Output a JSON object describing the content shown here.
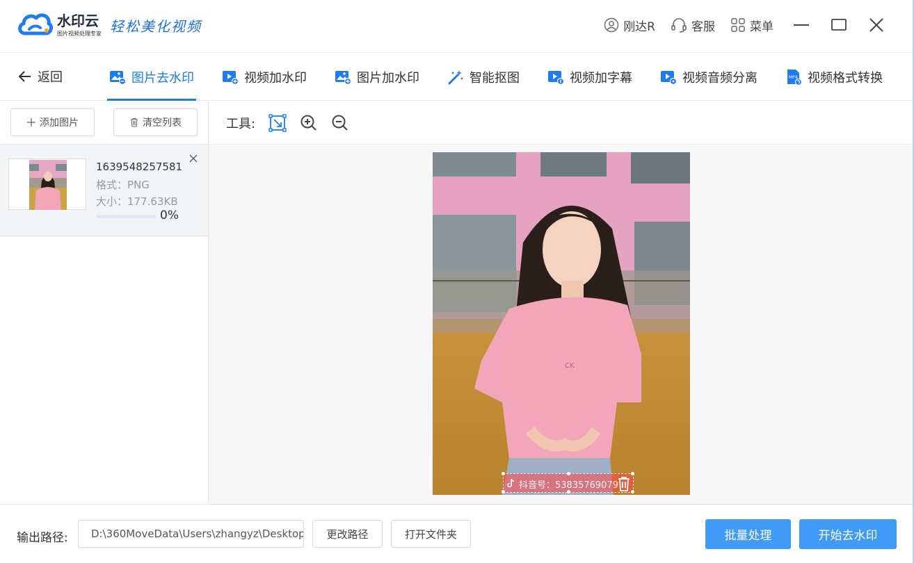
{
  "app": {
    "logo_name": "水印云",
    "logo_subtitle": "图片视频处理专家",
    "slogan": "轻松美化视频",
    "user_name": "刚达R",
    "service_label": "客服",
    "menu_label": "菜单",
    "user_icon": "user-circle-icon",
    "service_icon": "headset-icon",
    "menu_icon": "grid-menu-icon"
  },
  "nav": {
    "back_label": "返回",
    "tabs": [
      {
        "label": "图片去水印",
        "icon": "image-remove-icon",
        "active": true
      },
      {
        "label": "视频加水印",
        "icon": "video-add-icon",
        "active": false
      },
      {
        "label": "图片加水印",
        "icon": "image-add-icon",
        "active": false
      },
      {
        "label": "智能抠图",
        "icon": "magic-wand-icon",
        "active": false
      },
      {
        "label": "视频加字幕",
        "icon": "video-subtitle-icon",
        "active": false
      },
      {
        "label": "视频音频分离",
        "icon": "audio-split-icon",
        "active": false
      },
      {
        "label": "视频格式转换",
        "icon": "mp4-convert-icon",
        "active": false
      }
    ]
  },
  "left_panel": {
    "add_label": "添加图片",
    "clear_label": "清空列表",
    "files": [
      {
        "name": "1639548257581",
        "format": "格式：PNG",
        "size": "大小：177.63KB",
        "progress_pct": 0,
        "progress_text": "0%"
      }
    ]
  },
  "toolbar": {
    "label": "工具:"
  },
  "watermark": {
    "text": "抖音号：53835769079",
    "icon": "tiktok-icon",
    "delete_icon": "trash-icon"
  },
  "bottom": {
    "output_label": "输出路径:",
    "output_path": "D:\\360MoveData\\Users\\zhangyz\\Desktop",
    "change_path_label": "更改路径",
    "open_folder_label": "打开文件夹",
    "batch_label": "批量处理",
    "start_label": "开始去水印"
  },
  "colors": {
    "accent": "#1e7bf0",
    "primary_button": "#3f9bf5",
    "watermark_highlight": "#ff4646"
  }
}
